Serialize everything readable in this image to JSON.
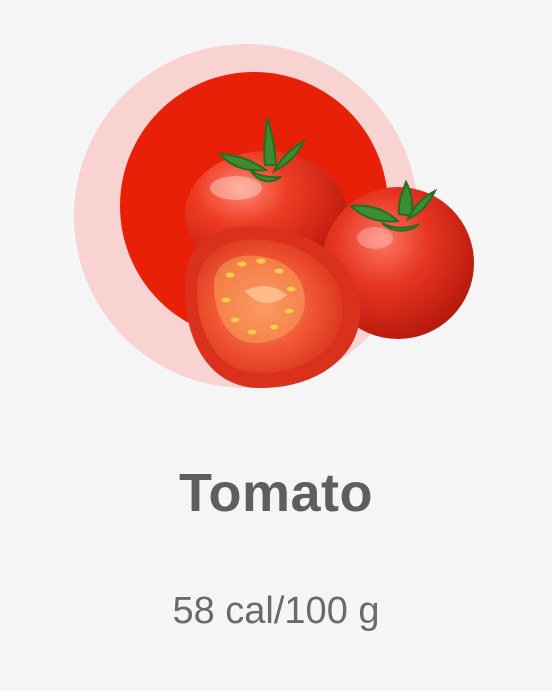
{
  "item": {
    "name": "Tomato",
    "calories": "58 cal/100 g"
  },
  "image": {
    "subject": "tomato-illustration"
  },
  "colors": {
    "outer_ring": "#f9d3d1",
    "inner_circle": "#e82008",
    "tomato": "#e3361f",
    "stem": "#3f8f2f",
    "title": "#5e5e5e",
    "subtitle": "#6a6a6a"
  }
}
